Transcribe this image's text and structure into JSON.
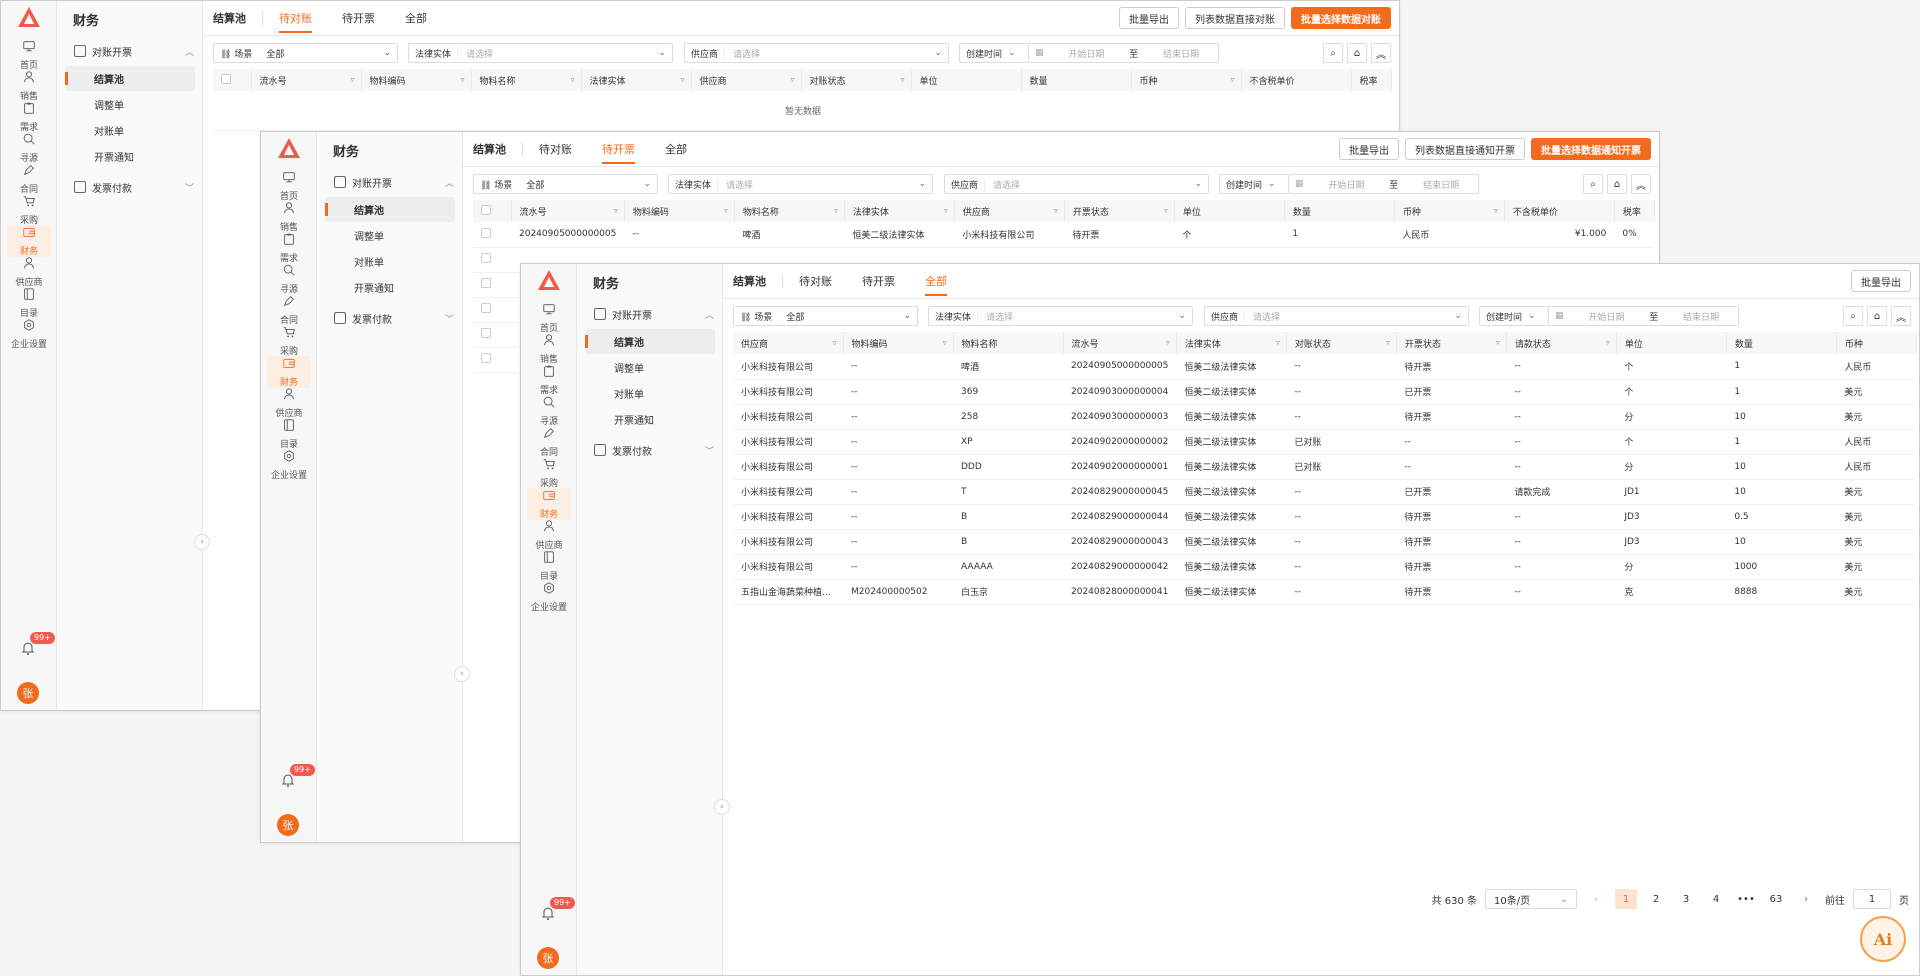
{
  "rail": {
    "items": [
      {
        "label": "首页",
        "icon": "monitor-icon"
      },
      {
        "label": "销售",
        "icon": "person-icon"
      },
      {
        "label": "需求",
        "icon": "clipboard-icon"
      },
      {
        "label": "寻源",
        "icon": "search-plus-icon"
      },
      {
        "label": "合同",
        "icon": "pen-icon"
      },
      {
        "label": "采购",
        "icon": "cart-icon"
      },
      {
        "label": "财务",
        "icon": "wallet-icon"
      },
      {
        "label": "供应商",
        "icon": "supplier-icon"
      },
      {
        "label": "目录",
        "icon": "catalog-icon"
      },
      {
        "label": "企业设置",
        "icon": "settings-icon"
      }
    ],
    "badge": "99+",
    "avatar": "张"
  },
  "subnav": {
    "title": "财务",
    "group1": "对账开票",
    "items": [
      "结算池",
      "调整单",
      "对账单",
      "开票通知"
    ],
    "group2": "发票付款"
  },
  "tabs": [
    "结算池",
    "待对账",
    "待开票",
    "全部"
  ],
  "filters": {
    "scene_label": "场景",
    "scene_value": "全部",
    "legal_entity": "法律实体",
    "supplier": "供应商",
    "placeholder": "请选择",
    "created_time": "创建时间",
    "start_date": "开始日期",
    "to": "至",
    "end_date": "结束日期"
  },
  "window1": {
    "buttons": [
      "批量导出",
      "列表数据直接对账",
      "批量选择数据对账"
    ],
    "columns": [
      "流水号",
      "物料编码",
      "物料名称",
      "法律实体",
      "供应商",
      "对账状态",
      "单位",
      "数量",
      "币种",
      "不含税单价",
      "税率"
    ],
    "empty": "暂无数据"
  },
  "window2": {
    "buttons": [
      "批量导出",
      "列表数据直接通知开票",
      "批量选择数据通知开票"
    ],
    "columns": [
      "流水号",
      "物料编码",
      "物料名称",
      "法律实体",
      "供应商",
      "开票状态",
      "单位",
      "数量",
      "币种",
      "不含税单价",
      "税率"
    ],
    "row": [
      "20240905000000005",
      "--",
      "啤酒",
      "恒美二级法律实体",
      "小米科技有限公司",
      "待开票",
      "个",
      "1",
      "人民币",
      "¥1.000",
      "0%"
    ]
  },
  "window3": {
    "buttons": [
      "批量导出"
    ],
    "columns": [
      "供应商",
      "物料编码",
      "物料名称",
      "流水号",
      "法律实体",
      "对账状态",
      "开票状态",
      "请款状态",
      "单位",
      "数量",
      "币种"
    ],
    "rows": [
      [
        "小米科技有限公司",
        "--",
        "啤酒",
        "20240905000000005",
        "恒美二级法律实体",
        "--",
        "待开票",
        "--",
        "个",
        "1",
        "人民币"
      ],
      [
        "小米科技有限公司",
        "--",
        "369",
        "20240903000000004",
        "恒美二级法律实体",
        "--",
        "已开票",
        "--",
        "个",
        "1",
        "美元"
      ],
      [
        "小米科技有限公司",
        "--",
        "258",
        "20240903000000003",
        "恒美二级法律实体",
        "--",
        "待开票",
        "--",
        "分",
        "10",
        "美元"
      ],
      [
        "小米科技有限公司",
        "--",
        "XP",
        "20240902000000002",
        "恒美二级法律实体",
        "已对账",
        "--",
        "--",
        "个",
        "1",
        "人民币"
      ],
      [
        "小米科技有限公司",
        "--",
        "DDD",
        "20240902000000001",
        "恒美二级法律实体",
        "已对账",
        "--",
        "--",
        "分",
        "10",
        "人民币"
      ],
      [
        "小米科技有限公司",
        "--",
        "T",
        "20240829000000045",
        "恒美二级法律实体",
        "--",
        "已开票",
        "请款完成",
        "JD1",
        "10",
        "美元"
      ],
      [
        "小米科技有限公司",
        "--",
        "B",
        "20240829000000044",
        "恒美二级法律实体",
        "--",
        "待开票",
        "--",
        "JD3",
        "0.5",
        "美元"
      ],
      [
        "小米科技有限公司",
        "--",
        "B",
        "20240829000000043",
        "恒美二级法律实体",
        "--",
        "待开票",
        "--",
        "JD3",
        "10",
        "美元"
      ],
      [
        "小米科技有限公司",
        "--",
        "AAAAA",
        "20240829000000042",
        "恒美二级法律实体",
        "--",
        "待开票",
        "--",
        "分",
        "1000",
        "美元"
      ],
      [
        "五指山金海蔬菜种植...",
        "M202400000502",
        "白玉京",
        "20240828000000041",
        "恒美二级法律实体",
        "--",
        "待开票",
        "--",
        "克",
        "8888",
        "美元"
      ]
    ],
    "pager": {
      "total": "共 630 条",
      "size": "10条/页",
      "pages": [
        "1",
        "2",
        "3",
        "4",
        "•••",
        "63"
      ],
      "goto": "前往",
      "goto_value": "1",
      "page_unit": "页"
    }
  },
  "ai_label": "Ai",
  "colors": {
    "accent": "#f26b1d",
    "badge": "#f05a4f"
  }
}
